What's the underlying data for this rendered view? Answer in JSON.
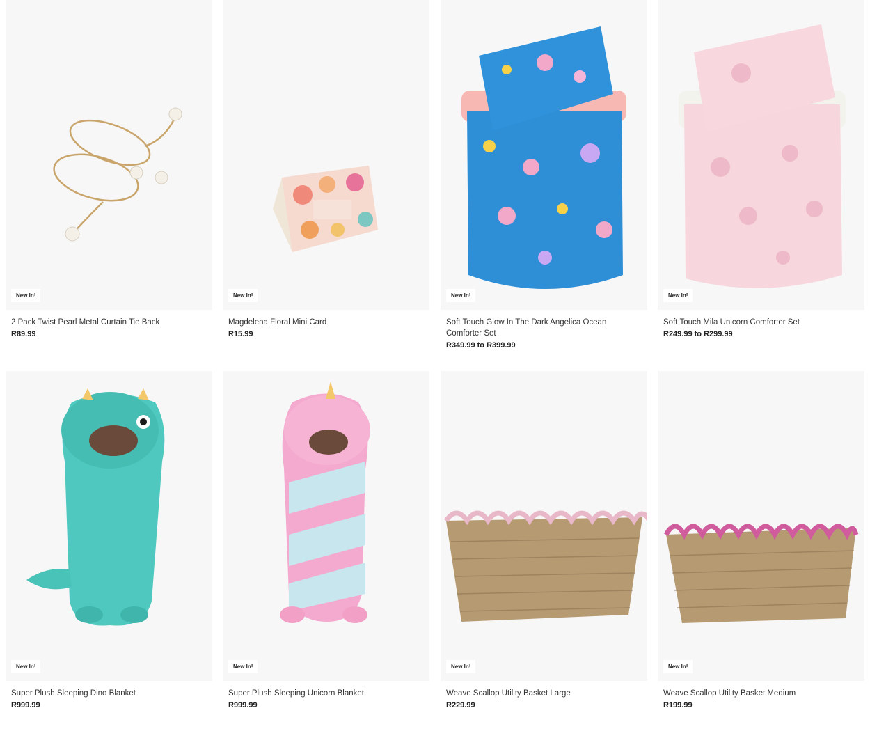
{
  "products": [
    {
      "name": "2 Pack Twist Pearl Metal Curtain Tie Back",
      "price": "R89.99",
      "badge": "New In!"
    },
    {
      "name": "Magdelena Floral Mini Card",
      "price": "R15.99",
      "badge": "New In!"
    },
    {
      "name": "Soft Touch Glow In The Dark Angelica Ocean Comforter Set",
      "price": "R349.99 to R399.99",
      "badge": "New In!"
    },
    {
      "name": "Soft Touch Mila Unicorn Comforter Set",
      "price": "R249.99 to R299.99",
      "badge": "New In!"
    },
    {
      "name": "Super Plush Sleeping Dino Blanket",
      "price": "R999.99",
      "badge": "New In!"
    },
    {
      "name": "Super Plush Sleeping Unicorn Blanket",
      "price": "R999.99",
      "badge": "New In!"
    },
    {
      "name": "Weave Scallop Utility Basket Large",
      "price": "R229.99",
      "badge": "New In!"
    },
    {
      "name": "Weave Scallop Utility Basket Medium",
      "price": "R199.99",
      "badge": "New In!"
    }
  ]
}
